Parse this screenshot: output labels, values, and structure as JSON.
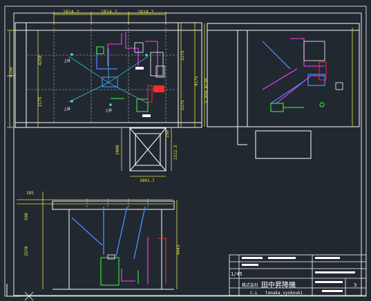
{
  "colors": {
    "background": "#212830",
    "frame": "#e8e8e8",
    "structure": "#ffffff",
    "dimension": "#e6e64a",
    "pipe_magenta": "#ff40ff",
    "pipe_red": "#ff2a2a",
    "pipe_green": "#40ff40",
    "pipe_cyan": "#40e0ff",
    "duct_blue": "#4a8cff"
  },
  "dimensions": {
    "top": [
      "1814.2",
      "1814.2",
      "1814.2"
    ],
    "left": [
      "4250",
      "4250",
      "2175"
    ],
    "mid_right": [
      "2275",
      "2275",
      "4175"
    ],
    "lower_a": [
      "350",
      "2000",
      "2312.5"
    ],
    "lower_b": "1601.7",
    "section_left": [
      "185",
      "590",
      "2570"
    ],
    "section_right": "4443",
    "side_vertical": "5,950 4230"
  },
  "plan_labels": {
    "a1": "上昇",
    "a2": "上昇",
    "a3": "上昇"
  },
  "title_block": {
    "company_prefix": "株式会社",
    "company_name": "田中昇降機",
    "line_label": "C.L",
    "romaji": "tanaka_syokouki",
    "scale": "1/45",
    "sheet_number": "3"
  },
  "icons": {
    "crosshair": "cursor-crosshair-icon",
    "ucs": "ucs-axis-icon"
  }
}
